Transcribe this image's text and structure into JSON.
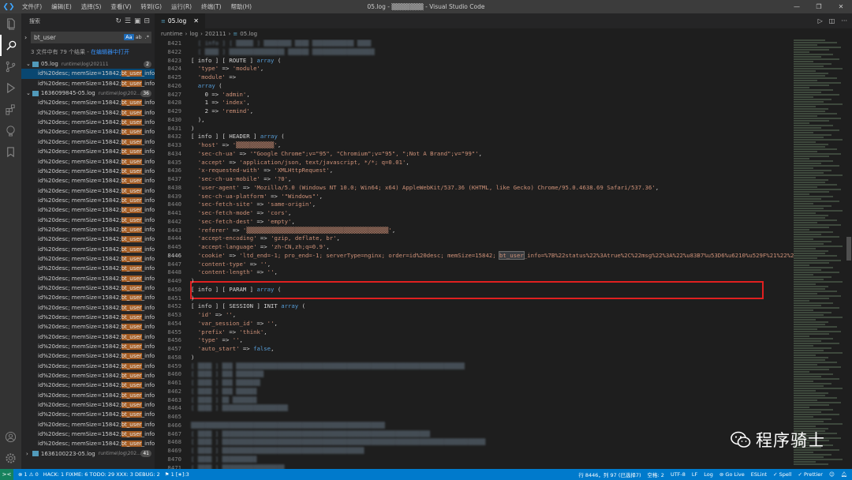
{
  "titlebar": {
    "menus": [
      "文件(F)",
      "编辑(E)",
      "选择(S)",
      "查看(V)",
      "转到(G)",
      "运行(R)",
      "终端(T)",
      "帮助(H)"
    ],
    "title": "05.log - ▒▒▒▒▒▒▒ - Visual Studio Code"
  },
  "sidebar": {
    "header": "搜索",
    "search_value": "bt_user",
    "option_case": "Aa",
    "option_word": "ab",
    "option_regex": ".*",
    "summary_prefix": "3 文件中有 79 个结果 - ",
    "summary_link": "在编辑器中打开",
    "files": [
      {
        "name": "05.log",
        "path": "runtime\\log\\202111",
        "count": "2"
      },
      {
        "name": "1636099845-05.log",
        "path": "runtime\\log\\202...",
        "count": "36"
      },
      {
        "name": "1636100223-05.log",
        "path": "runtime\\log\\202...",
        "count": "41"
      }
    ],
    "result_prefix": "id%20desc; memSize=15842; ",
    "result_match": "bt_user",
    "result_suffix": "_info=..."
  },
  "editor": {
    "tab_label": "05.log",
    "breadcrumb": [
      "runtime",
      "log",
      "202111",
      "05.log"
    ],
    "code_lines": [
      {
        "n": "8421",
        "t": "bl",
        "c": "  [ info ] [ ▒▒▒▒▒ ] ▒▒▒▒▒▒▒▒ ▒▒▒▒ ▒▒▒▒▒▒▒▒▒▒▒▒ ▒▒▒▒"
      },
      {
        "n": "8422",
        "t": "bl",
        "c": "  [ ▒▒▒▒ ] ▒▒▒▒▒▒▒▒▒▒▒▒▒▒▒▒ ▒▒▒▒▒▒ ▒▒▒▒▒▒▒▒▒▒▒▒▒▒▒▒▒▒"
      },
      {
        "n": "8423",
        "t": "code",
        "c": "[ info ] [ ROUTE ] array ("
      },
      {
        "n": "8424",
        "t": "code",
        "c": "  'type' => 'module',"
      },
      {
        "n": "8425",
        "t": "code",
        "c": "  'module' =>"
      },
      {
        "n": "8426",
        "t": "code",
        "c": "  array ("
      },
      {
        "n": "8427",
        "t": "code",
        "c": "    0 => 'admin',"
      },
      {
        "n": "8428",
        "t": "code",
        "c": "    1 => 'index',"
      },
      {
        "n": "8429",
        "t": "code",
        "c": "    2 => 'remind',"
      },
      {
        "n": "8430",
        "t": "code",
        "c": "  ),"
      },
      {
        "n": "8431",
        "t": "code",
        "c": ")"
      },
      {
        "n": "8432",
        "t": "code",
        "c": "[ info ] [ HEADER ] array ("
      },
      {
        "n": "8433",
        "t": "code",
        "c": "  'host' => '▒▒▒▒▒▒▒▒▒▒▒',"
      },
      {
        "n": "8434",
        "t": "code",
        "c": "  'sec-ch-ua' => '\"Google Chrome\";v=\"95\", \"Chromium\";v=\"95\", \";Not A Brand\";v=\"99\"',"
      },
      {
        "n": "8435",
        "t": "code",
        "c": "  'accept' => 'application/json, text/javascript, */*; q=0.01',"
      },
      {
        "n": "8436",
        "t": "code",
        "c": "  'x-requested-with' => 'XMLHttpRequest',"
      },
      {
        "n": "8437",
        "t": "code",
        "c": "  'sec-ch-ua-mobile' => '?0',"
      },
      {
        "n": "8438",
        "t": "code",
        "c": "  'user-agent' => 'Mozilla/5.0 (Windows NT 10.0; Win64; x64) AppleWebKit/537.36 (KHTML, like Gecko) Chrome/95.0.4638.69 Safari/537.36',"
      },
      {
        "n": "8439",
        "t": "code",
        "c": "  'sec-ch-ua-platform' => '\"Windows\"',"
      },
      {
        "n": "8440",
        "t": "code",
        "c": "  'sec-fetch-site' => 'same-origin',"
      },
      {
        "n": "8441",
        "t": "code",
        "c": "  'sec-fetch-mode' => 'cors',"
      },
      {
        "n": "8442",
        "t": "code",
        "c": "  'sec-fetch-dest' => 'empty',"
      },
      {
        "n": "8443",
        "t": "code",
        "c": "  'referer' => '▒▒▒▒▒▒▒▒▒▒▒▒▒▒▒▒▒▒▒▒▒▒▒▒▒▒▒▒▒▒▒▒▒▒▒▒▒▒▒▒▒',"
      },
      {
        "n": "8444",
        "t": "code",
        "c": "  'accept-encoding' => 'gzip, deflate, br',"
      },
      {
        "n": "8445",
        "t": "code",
        "c": "  'accept-language' => 'zh-CN,zh;q=0.9',"
      },
      {
        "n": "8446",
        "t": "cookie",
        "c": "  'cookie' => 'ltd_end=-1; pro_end=-1; serverType=nginx; order=id%20desc; memSize=15842; ",
        "hl": "bt_user",
        "rest": "_info=%7B%22status%22%3Atrue%2C%22msg%22%3A%22%u83B7%u53D6%u6210%u529F%21%22%2C%"
      },
      {
        "n": "8447",
        "t": "code",
        "c": "  'content-type' => '',"
      },
      {
        "n": "8448",
        "t": "code",
        "c": "  'content-length' => '',"
      },
      {
        "n": "8449",
        "t": "code",
        "c": ")"
      },
      {
        "n": "8450",
        "t": "code",
        "c": "[ info ] [ PARAM ] array ("
      },
      {
        "n": "8451",
        "t": "code",
        "c": ")"
      },
      {
        "n": "8452",
        "t": "code",
        "c": "[ info ] [ SESSION ] INIT array ("
      },
      {
        "n": "8453",
        "t": "code",
        "c": "  'id' => '',"
      },
      {
        "n": "8454",
        "t": "code",
        "c": "  'var_session_id' => '',"
      },
      {
        "n": "8455",
        "t": "code",
        "c": "  'prefix' => 'think',"
      },
      {
        "n": "8456",
        "t": "code",
        "c": "  'type' => '',"
      },
      {
        "n": "8457",
        "t": "code",
        "c": "  'auto_start' => false,"
      },
      {
        "n": "8458",
        "t": "code",
        "c": ")"
      },
      {
        "n": "8459",
        "t": "bl",
        "c": "[ ▒▒▒▒ ] ▒▒▒ ▒▒▒▒▒▒▒▒▒▒▒▒▒▒▒▒▒▒▒▒▒▒▒▒▒▒▒▒▒▒▒▒▒▒▒▒▒▒▒▒▒▒▒▒▒▒▒▒▒▒▒▒▒▒▒▒▒▒▒▒▒▒▒▒▒▒"
      },
      {
        "n": "8460",
        "t": "bl",
        "c": "[ ▒▒▒▒ ] ▒▒▒ ▒▒▒▒▒▒▒▒"
      },
      {
        "n": "8461",
        "t": "bl",
        "c": "[ ▒▒▒▒ ] ▒▒▒ ▒▒▒▒▒▒▒"
      },
      {
        "n": "8462",
        "t": "bl",
        "c": "[ ▒▒▒▒ ] ▒▒▒ ▒▒▒▒▒▒"
      },
      {
        "n": "8463",
        "t": "bl",
        "c": "[ ▒▒▒▒ ] ▒▒ ▒▒▒▒▒▒▒"
      },
      {
        "n": "8464",
        "t": "bl",
        "c": "[ ▒▒▒▒ ] ▒▒▒▒▒▒▒▒▒▒▒▒▒▒▒▒▒▒▒"
      },
      {
        "n": "8465",
        "t": "bl",
        "c": ""
      },
      {
        "n": "8466",
        "t": "bl",
        "c": "▒▒▒▒▒▒▒▒▒▒▒▒▒▒▒▒▒▒▒▒▒▒▒▒▒▒▒▒▒▒▒▒▒▒▒▒▒▒▒▒▒▒▒▒▒▒▒▒▒▒▒▒▒▒▒▒"
      },
      {
        "n": "8467",
        "t": "bl",
        "c": "[ ▒▒▒▒ ] ▒▒▒▒▒▒▒▒▒▒▒▒▒▒▒▒▒▒▒▒▒▒▒▒▒▒▒▒▒▒▒▒▒▒▒▒▒▒▒▒▒▒▒▒▒▒▒▒▒▒▒▒▒▒▒▒▒▒▒▒"
      },
      {
        "n": "8468",
        "t": "bl",
        "c": "[ ▒▒▒▒ ] ▒▒▒▒▒▒▒▒▒▒▒▒▒▒▒▒▒▒▒▒▒▒▒▒▒▒▒▒▒▒▒▒▒▒▒▒▒▒▒▒▒▒▒▒▒▒▒▒▒▒▒▒▒▒▒▒▒▒▒▒▒▒▒▒▒▒▒▒▒▒▒▒▒▒▒▒"
      },
      {
        "n": "8469",
        "t": "bl",
        "c": "[ ▒▒▒▒ ] ▒▒▒▒▒▒▒▒▒▒▒▒▒▒▒▒▒▒▒▒▒▒▒▒▒▒▒▒▒▒▒▒▒▒▒▒▒▒▒▒▒"
      },
      {
        "n": "8470",
        "t": "bl",
        "c": "[ ▒▒▒▒ ] ▒▒▒▒▒▒▒▒▒▒"
      },
      {
        "n": "8471",
        "t": "bl",
        "c": "[ ▒▒▒▒ ] ▒▒▒▒▒▒▒▒▒▒▒▒▒▒▒▒▒▒"
      }
    ]
  },
  "statusbar": {
    "remote": "><",
    "errors": "⊗ 1 ⚠ 0",
    "todo": "HACK: 1 FIXME: 6 TODO: 29 XXX: 3 DEBUG: 2",
    "extra": "⚑ 1 [∗]:3",
    "position": "行 8446，列 97 (已选择7)",
    "spaces": "空格: 2",
    "encoding": "UTF-8",
    "eol": "LF",
    "lang": "Log",
    "golive": "Go Live",
    "eslint": "ESLint",
    "spell": "Spell",
    "prettier": "Prettier"
  },
  "watermark": {
    "text": "程序骑士"
  }
}
